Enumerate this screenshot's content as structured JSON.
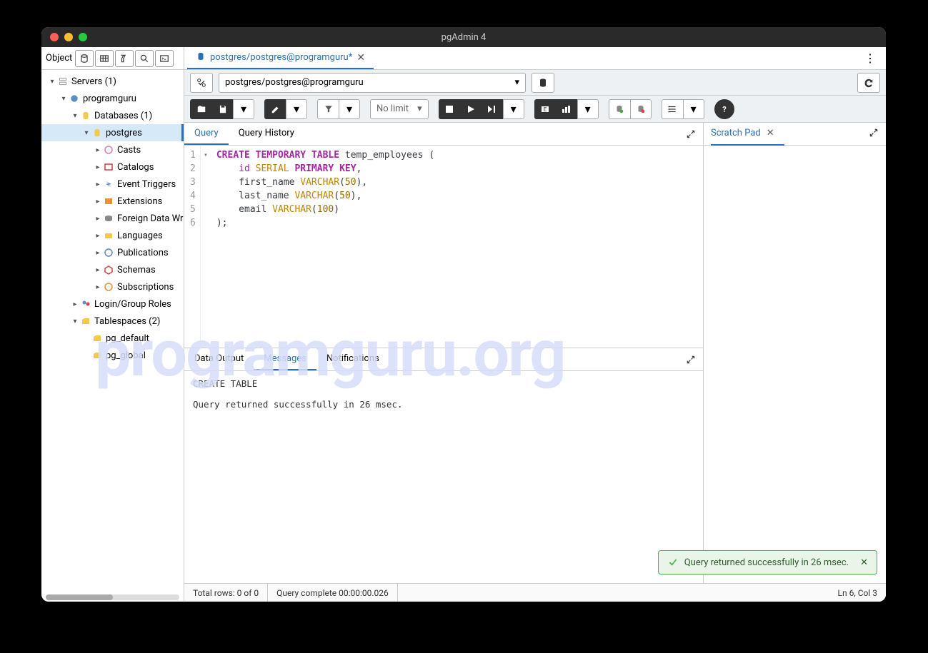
{
  "window": {
    "title": "pgAdmin 4"
  },
  "sidebar": {
    "header_label": "Object",
    "items": [
      {
        "label": "Servers (1)"
      },
      {
        "label": "programguru"
      },
      {
        "label": "Databases (1)"
      },
      {
        "label": "postgres"
      },
      {
        "label": "Casts"
      },
      {
        "label": "Catalogs"
      },
      {
        "label": "Event Triggers"
      },
      {
        "label": "Extensions"
      },
      {
        "label": "Foreign Data Wr"
      },
      {
        "label": "Languages"
      },
      {
        "label": "Publications"
      },
      {
        "label": "Schemas"
      },
      {
        "label": "Subscriptions"
      },
      {
        "label": "Login/Group Roles"
      },
      {
        "label": "Tablespaces (2)"
      },
      {
        "label": "pg_default"
      },
      {
        "label": "pg_global"
      }
    ]
  },
  "file_tab": {
    "label": "postgres/postgres@programguru*"
  },
  "connection": {
    "value": "postgres/postgres@programguru"
  },
  "toolbar": {
    "limit_label": "No limit"
  },
  "editor_tabs": {
    "query": "Query",
    "history": "Query History"
  },
  "scratch": {
    "title": "Scratch Pad"
  },
  "code": {
    "lines": [
      "1",
      "2",
      "3",
      "4",
      "5",
      "6"
    ],
    "l1": {
      "a": "CREATE",
      "b": "TEMPORARY",
      "c": "TABLE",
      "d": "temp_employees",
      "e": "("
    },
    "l2": {
      "a": "id",
      "b": "SERIAL",
      "c": "PRIMARY",
      "d": "KEY",
      "e": ","
    },
    "l3": {
      "a": "first_name",
      "b": "VARCHAR",
      "c": "(",
      "d": "50",
      "e": ")",
      "f": ","
    },
    "l4": {
      "a": "last_name",
      "b": "VARCHAR",
      "c": "(",
      "d": "50",
      "e": ")",
      "f": ","
    },
    "l5": {
      "a": "email",
      "b": "VARCHAR",
      "c": "(",
      "d": "100",
      "e": ")"
    },
    "l6": {
      "a": ");"
    }
  },
  "output_tabs": {
    "data": "Data Output",
    "messages": "Messages",
    "notifications": "Notifications"
  },
  "messages": {
    "line1": "CREATE TABLE",
    "line2": "Query returned successfully in 26 msec."
  },
  "status": {
    "rows": "Total rows: 0 of 0",
    "complete": "Query complete 00:00:00.026",
    "cursor": "Ln 6, Col 3"
  },
  "toast": {
    "text": "Query returned successfully in 26 msec."
  },
  "watermark": "programguru.org"
}
